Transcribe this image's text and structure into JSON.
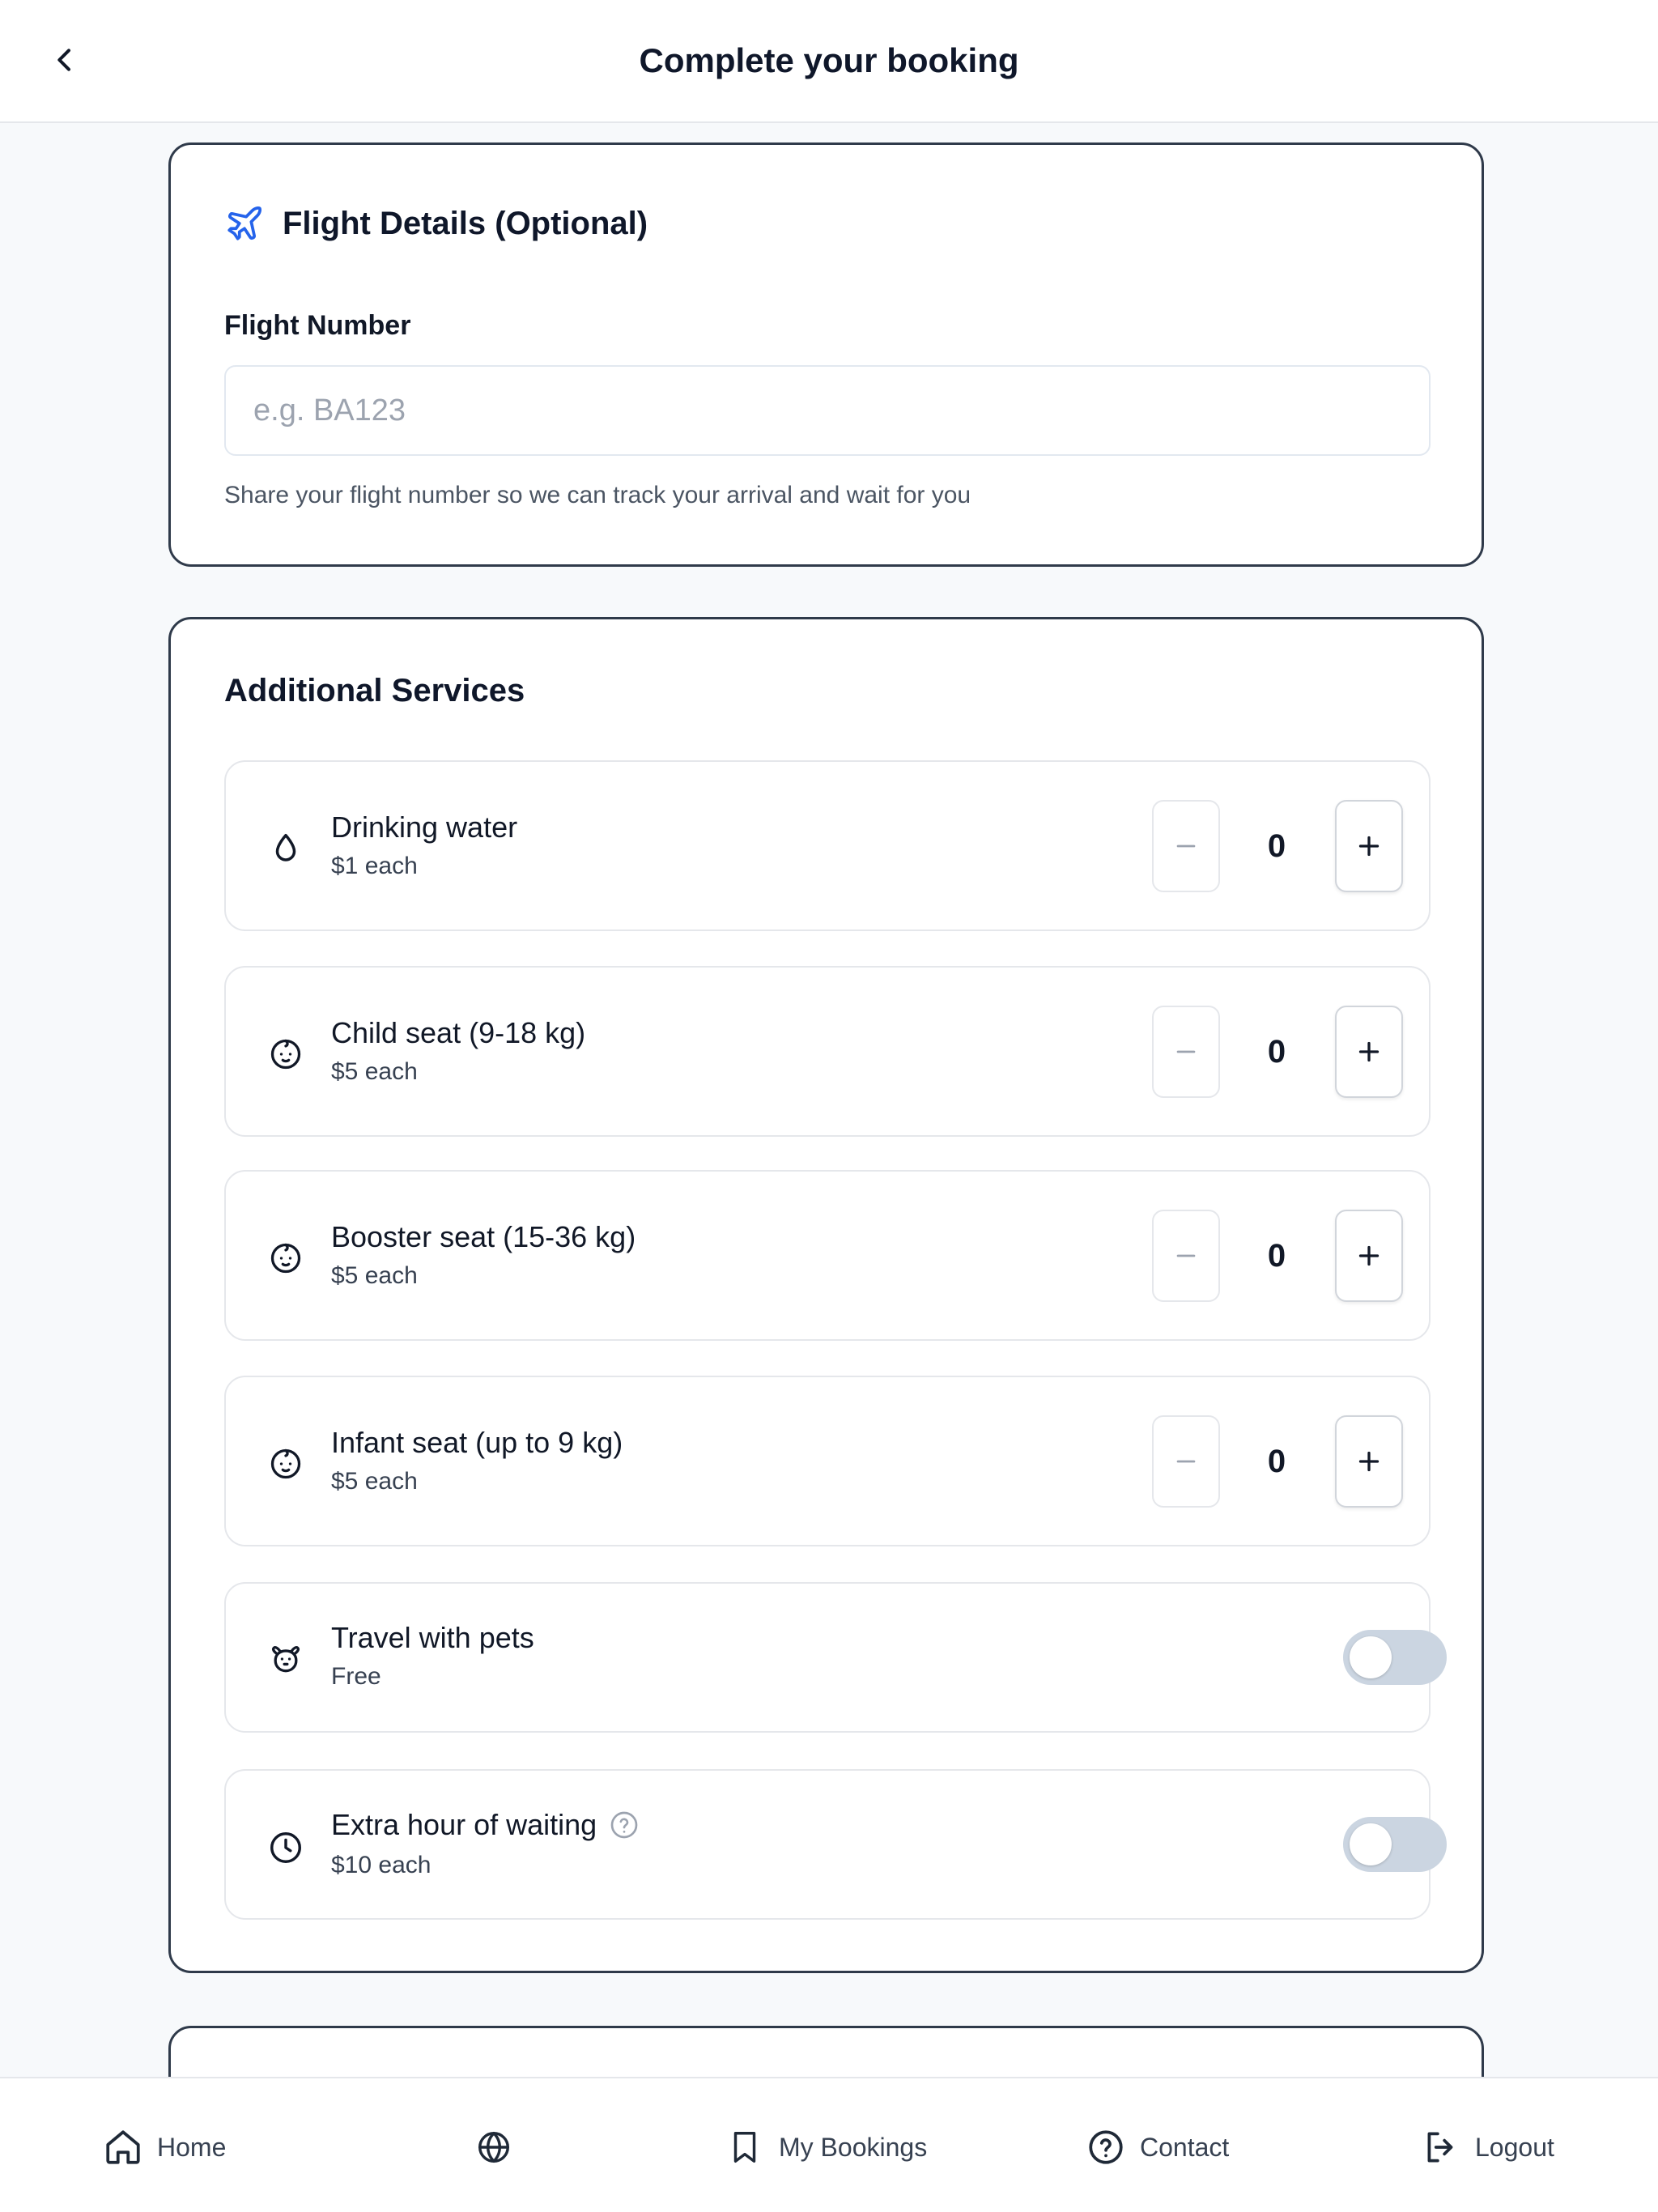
{
  "header": {
    "title": "Complete your booking"
  },
  "flight": {
    "title": "Flight Details (Optional)",
    "label": "Flight Number",
    "value": "",
    "placeholder": "e.g. BA123",
    "helper": "Share your flight number so we can track your arrival and wait for you"
  },
  "services": {
    "title": "Additional Services",
    "items": [
      {
        "name": "Drinking water",
        "price": "$1 each",
        "count": "0",
        "icon": "droplet-icon"
      },
      {
        "name": "Child seat (9-18 kg)",
        "price": "$5 each",
        "count": "0",
        "icon": "baby-icon"
      },
      {
        "name": "Booster seat (15-36 kg)",
        "price": "$5 each",
        "count": "0",
        "icon": "baby-icon"
      },
      {
        "name": "Infant seat (up to 9 kg)",
        "price": "$5 each",
        "count": "0",
        "icon": "baby-icon"
      },
      {
        "name": "Travel with pets",
        "price": "Free",
        "toggle": false,
        "icon": "pet-icon"
      },
      {
        "name": "Extra hour of waiting",
        "price": "$10 each",
        "toggle": false,
        "icon": "clock-icon"
      }
    ]
  },
  "nav": {
    "home": "Home",
    "bookings": "My Bookings",
    "contact": "Contact",
    "logout": "Logout"
  },
  "colors": {
    "accent": "#2563eb",
    "card_border": "#2f3a4a",
    "toggle_off": "#cbd5e1",
    "background": "#f7f9fb"
  }
}
